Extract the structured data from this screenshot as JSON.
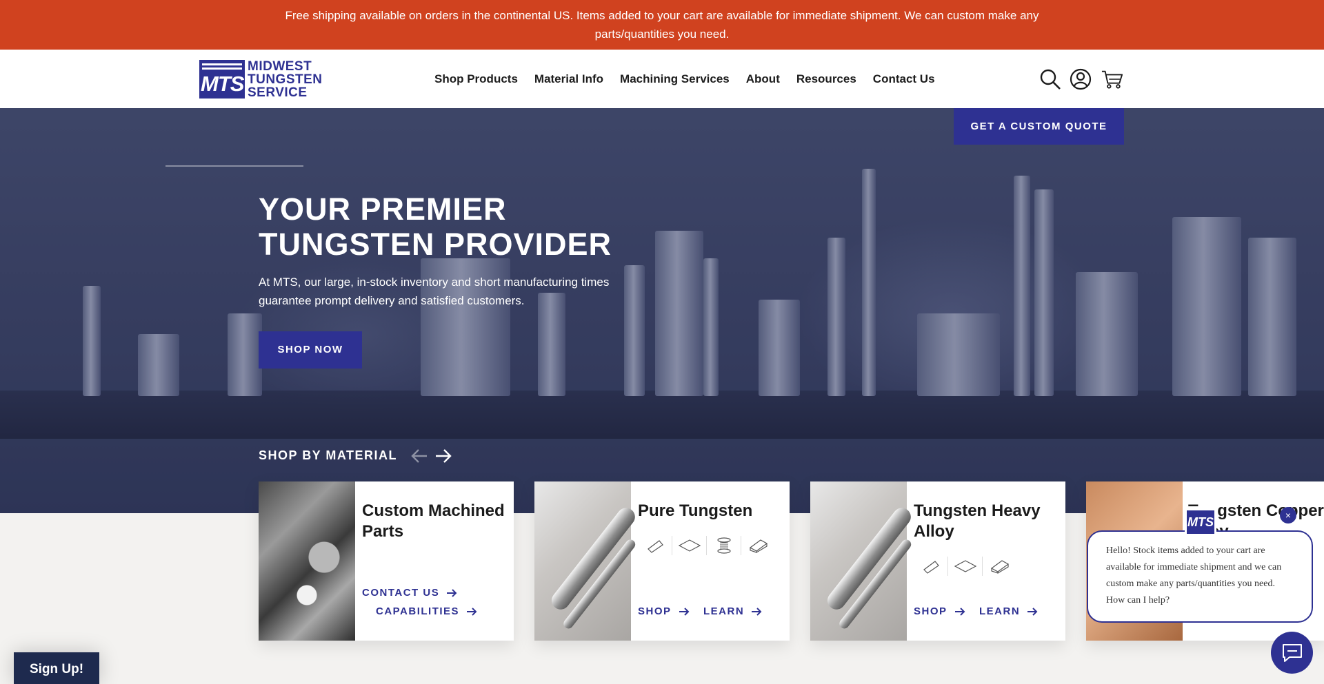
{
  "announcement": {
    "text": "Free shipping available on orders in the continental US. Items added to your cart are available for immediate shipment. We can custom make any parts/quantities you need."
  },
  "brand": {
    "mark": "MTS",
    "line1": "MIDWEST",
    "line2": "TUNGSTEN",
    "line3": "SERVICE",
    "color": "#2e3192"
  },
  "nav": {
    "items": [
      {
        "label": "Shop Products"
      },
      {
        "label": "Material Info"
      },
      {
        "label": "Machining Services"
      },
      {
        "label": "About"
      },
      {
        "label": "Resources"
      },
      {
        "label": "Contact Us"
      }
    ],
    "icons": [
      "search-icon",
      "account-icon",
      "cart-icon"
    ]
  },
  "hero": {
    "quote_button": "GET A CUSTOM QUOTE",
    "title_line1": "YOUR PREMIER",
    "title_line2": "TUNGSTEN PROVIDER",
    "subtitle": "At MTS, our large, in-stock inventory and short manufacturing times guarantee prompt delivery and satisfied customers.",
    "cta": "SHOP NOW"
  },
  "materials": {
    "heading": "SHOP BY MATERIAL",
    "cards": [
      {
        "title": "Custom Machined Parts",
        "link1": "CONTACT US",
        "link2": "CAPABILITIES"
      },
      {
        "title": "Pure Tungsten",
        "link1": "SHOP",
        "link2": "LEARN"
      },
      {
        "title": "Tungsten Heavy Alloy",
        "link1": "SHOP",
        "link2": "LEARN"
      },
      {
        "title": "Tungsten Copper Alloy"
      }
    ]
  },
  "chat": {
    "message": "Hello! Stock items added to your cart are available for immediate shipment and we can custom make any parts/quantities you need. How can I help?",
    "avatar": "MTS",
    "close": "×"
  },
  "signup": {
    "label": "Sign Up!"
  },
  "colors": {
    "announce": "#d0421f",
    "primary": "#2e3192",
    "signup": "#1e2a4e"
  }
}
